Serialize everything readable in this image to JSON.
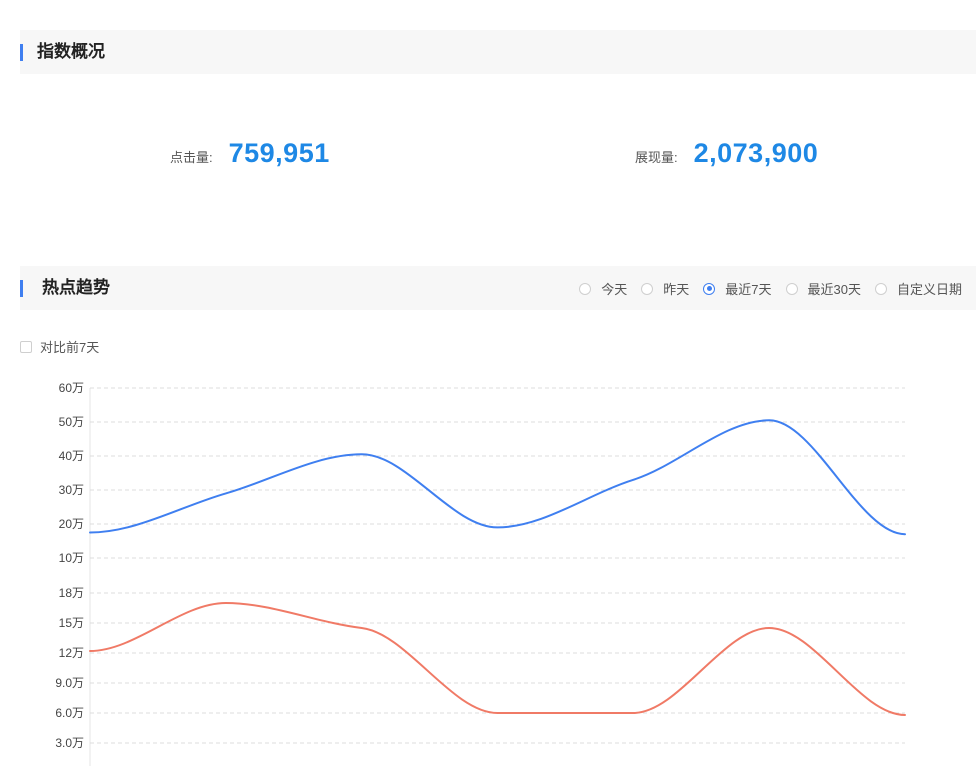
{
  "overview": {
    "title": "指数概况",
    "clicks_label": "点击量:",
    "clicks_value": "759,951",
    "impressions_label": "展现量:",
    "impressions_value": "2,073,900"
  },
  "trend": {
    "title": "热点趋势",
    "range_options": [
      {
        "label": "今天",
        "selected": false
      },
      {
        "label": "昨天",
        "selected": false
      },
      {
        "label": "最近7天",
        "selected": true
      },
      {
        "label": "最近30天",
        "selected": false
      },
      {
        "label": "自定义日期",
        "selected": false
      }
    ],
    "compare_label": "对比前7天",
    "compare_checked": false
  },
  "colors": {
    "accent": "#3f7ff0",
    "value_blue": "#1e88e5",
    "series_top": "#3f7ff0",
    "series_bottom": "#f07a66"
  },
  "chart_data": [
    {
      "type": "line",
      "smooth": true,
      "ylim": [
        10,
        60
      ],
      "y_ticks": [
        10,
        20,
        30,
        40,
        50,
        60
      ],
      "y_tick_labels": [
        "10万",
        "20万",
        "30万",
        "40万",
        "50万",
        "60万"
      ],
      "grid": "horizontal-dashed",
      "x": [
        1,
        2,
        3,
        4,
        5,
        6,
        7
      ],
      "series": [
        {
          "values": [
            17.5,
            29,
            40.5,
            19,
            33,
            50.5,
            17
          ]
        }
      ]
    },
    {
      "type": "line",
      "smooth": true,
      "ylim": [
        3,
        18
      ],
      "y_ticks": [
        3,
        6,
        9,
        12,
        15,
        18
      ],
      "y_tick_labels": [
        "3.0万",
        "6.0万",
        "9.0万",
        "12万",
        "15万",
        "18万"
      ],
      "grid": "horizontal-dashed",
      "x": [
        1,
        2,
        3,
        4,
        5,
        6,
        7
      ],
      "series": [
        {
          "values": [
            12.2,
            17,
            14.5,
            6,
            6,
            14.5,
            5.8
          ]
        }
      ]
    }
  ]
}
